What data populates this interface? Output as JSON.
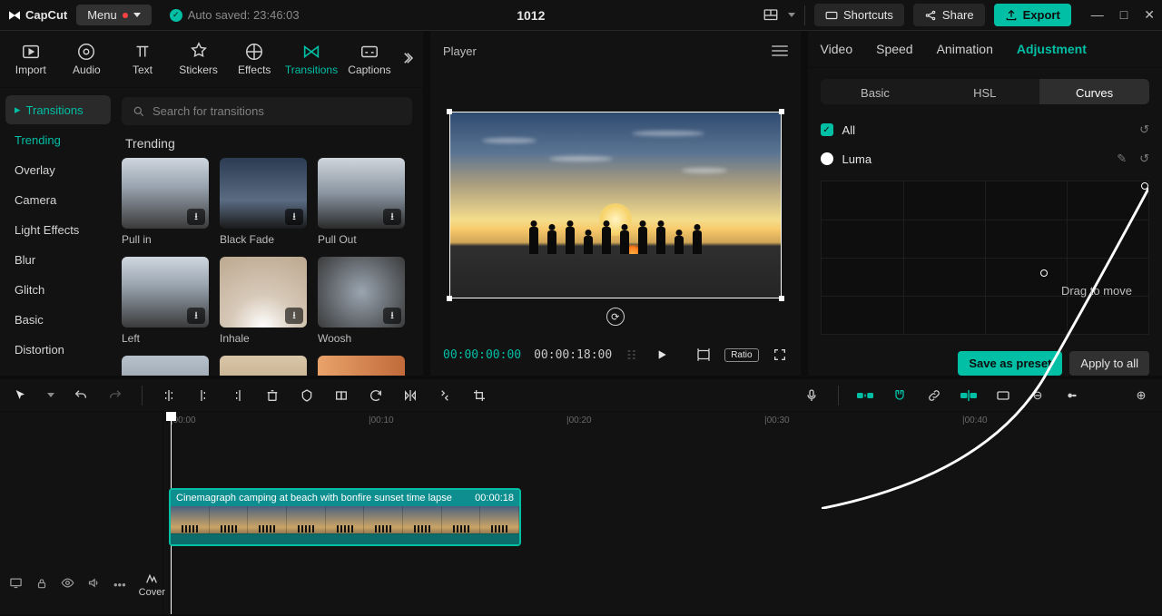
{
  "app_name": "CapCut",
  "menu_label": "Menu",
  "auto_saved": "Auto saved: 23:46:03",
  "project_title": "1012",
  "shortcuts": "Shortcuts",
  "share": "Share",
  "export": "Export",
  "tool_tabs": {
    "import": "Import",
    "audio": "Audio",
    "text": "Text",
    "stickers": "Stickers",
    "effects": "Effects",
    "transitions": "Transitions",
    "captions": "Captions"
  },
  "sub_sidebar": {
    "transitions": "Transitions",
    "trending": "Trending",
    "overlay": "Overlay",
    "camera": "Camera",
    "light": "Light Effects",
    "blur": "Blur",
    "glitch": "Glitch",
    "basic": "Basic",
    "distortion": "Distortion"
  },
  "search_placeholder": "Search for transitions",
  "section_title": "Trending",
  "thumbs": [
    {
      "label": "Pull in"
    },
    {
      "label": "Black Fade"
    },
    {
      "label": "Pull Out"
    },
    {
      "label": "Left"
    },
    {
      "label": "Inhale"
    },
    {
      "label": "Woosh"
    },
    {
      "label": ""
    },
    {
      "label": ""
    },
    {
      "label": ""
    }
  ],
  "player_title": "Player",
  "time_current": "00:00:00:00",
  "time_duration": "00:00:18:00",
  "right_panel": {
    "tabs": {
      "video": "Video",
      "speed": "Speed",
      "animation": "Animation",
      "adjustment": "Adjustment"
    },
    "segs": {
      "basic": "Basic",
      "hsl": "HSL",
      "curves": "Curves"
    },
    "all": "All",
    "luma": "Luma",
    "drag_hint": "Drag to move",
    "save_preset": "Save as preset",
    "apply_all": "Apply to all"
  },
  "timeline": {
    "ruler": [
      "|00:00",
      "|00:10",
      "|00:20",
      "|00:30",
      "|00:40"
    ],
    "cover": "Cover",
    "clip_name": "Cinemagraph camping at beach with bonfire sunset time lapse",
    "clip_dur": "00:00:18"
  }
}
